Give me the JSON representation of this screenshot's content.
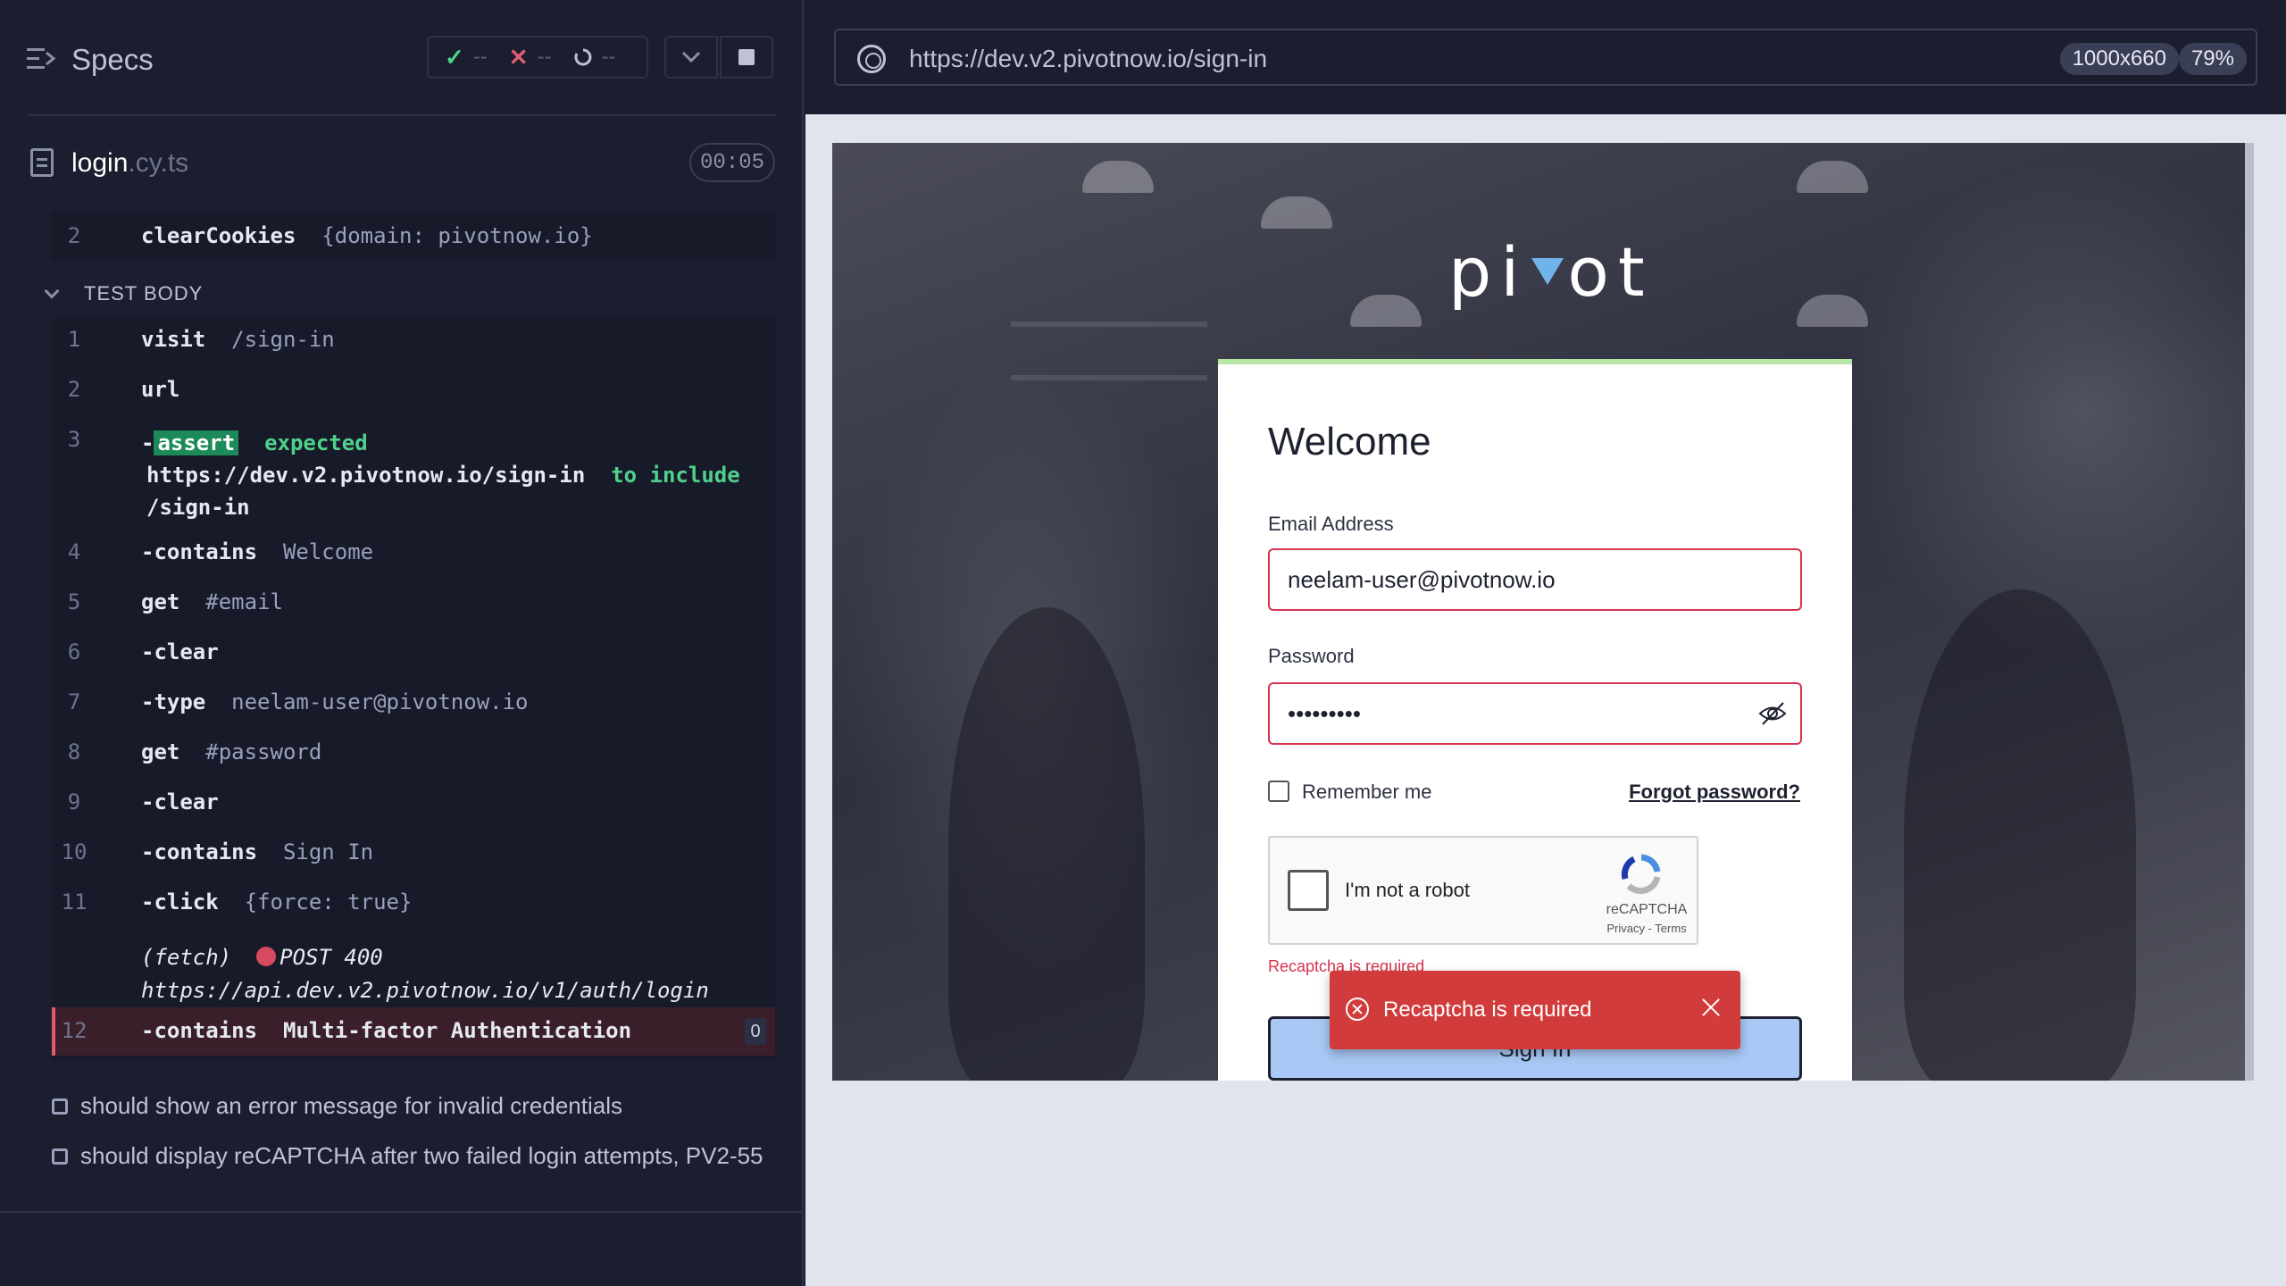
{
  "reporter": {
    "title": "Specs",
    "stats": {
      "passed": "--",
      "failed": "--",
      "pending": "--"
    },
    "spec_file": {
      "name": "login",
      "ext": ".cy.ts"
    },
    "timer": "00:05",
    "before_hook": {
      "num": "2",
      "name": "clearCookies",
      "arg": "{domain: pivotnow.io}"
    },
    "test_body_label": "TEST BODY",
    "commands": [
      {
        "num": "1",
        "name": "visit",
        "arg": "/sign-in"
      },
      {
        "num": "2",
        "name": "url",
        "arg": ""
      },
      {
        "num": "3",
        "badge": "assert",
        "expected": "expected",
        "url": "https://dev.v2.pivotnow.io/sign-in",
        "to_include": "to include",
        "path": "/sign-in"
      },
      {
        "num": "4",
        "name": "contains",
        "arg": "Welcome"
      },
      {
        "num": "5",
        "name": "get",
        "arg": "#email"
      },
      {
        "num": "6",
        "name": "clear",
        "arg": ""
      },
      {
        "num": "7",
        "name": "type",
        "arg": "neelam-user@pivotnow.io"
      },
      {
        "num": "8",
        "name": "get",
        "arg": "#password"
      },
      {
        "num": "9",
        "name": "clear",
        "arg": ""
      },
      {
        "num": "10",
        "name": "contains",
        "arg": "Sign In"
      },
      {
        "num": "11",
        "name": "click",
        "arg": "{force: true}"
      },
      {
        "fetch_label": "(fetch)",
        "status": "POST 400",
        "url": "https://api.dev.v2.pivotnow.io/v1/auth/login"
      },
      {
        "num": "12",
        "name": "contains",
        "arg": "Multi-factor Authentication",
        "count": "0"
      }
    ],
    "tests": [
      "should show an error message for invalid credentials",
      "should display reCAPTCHA after two failed login attempts, PV2-55"
    ]
  },
  "runner": {
    "url": "https://dev.v2.pivotnow.io/sign-in",
    "viewport": "1000x660",
    "zoom": "79%"
  },
  "app": {
    "logo": "pivot",
    "welcome": "Welcome",
    "email_label": "Email Address",
    "email_value": "neelam-user@pivotnow.io",
    "password_label": "Password",
    "password_value": "•••••••••",
    "remember_label": "Remember me",
    "forgot_label": "Forgot password?",
    "captcha_text": "I'm not a robot",
    "captcha_brand": "reCAPTCHA",
    "captcha_links": "Privacy - Terms",
    "captcha_error": "Recaptcha is required",
    "signin_label": "Sign In",
    "toast_message": "Recaptcha is required"
  },
  "colors": {
    "passed": "#4fd18b",
    "failed": "#e05a73",
    "error_red": "#d6334f",
    "toast_bg": "#d13b3b",
    "signin_bg": "#a9c8f5"
  }
}
